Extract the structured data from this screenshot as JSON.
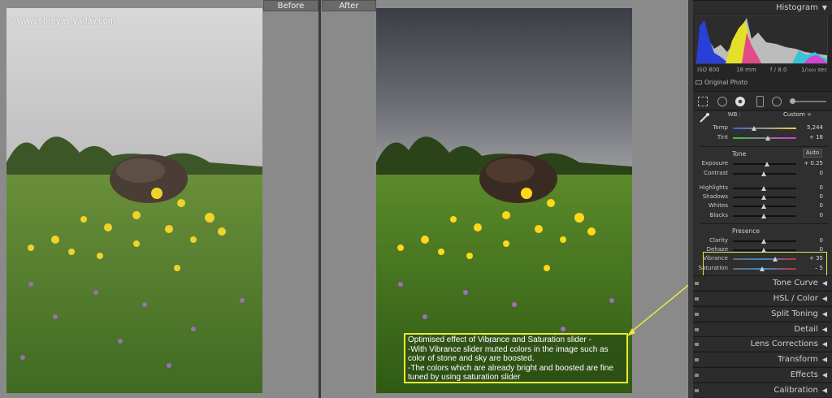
{
  "watermark": "© www.shreyas-yadav.com",
  "before_label": "Before",
  "after_label": "After",
  "annotation_lines": [
    "Optimised effect of Vibrance and Saturation slider -",
    "-With Vibrance slider muted colors in the image such as",
    "color of stone and sky are boosted.",
    "-The colors which are already bright and boosted are fine",
    "tuned  by using saturation slider"
  ],
  "panel": {
    "histogram_title": "Histogram",
    "iso": "ISO 800",
    "focal": "18 mm",
    "aperture": "f / 8.0",
    "shutter": "1/₁₆₀₀ sec",
    "original_photo": "Original Photo",
    "wb_label": "WB :",
    "wb_value": "Custom",
    "temp_label": "Temp",
    "temp_value": "5,244",
    "tint_label": "Tint",
    "tint_value": "+ 18",
    "tone_title": "Tone",
    "auto_label": "Auto",
    "exposure_label": "Exposure",
    "exposure_value": "+ 0.25",
    "contrast_label": "Contrast",
    "contrast_value": "0",
    "highlights_label": "Highlights",
    "highlights_value": "0",
    "shadows_label": "Shadows",
    "shadows_value": "0",
    "whites_label": "Whites",
    "whites_value": "0",
    "blacks_label": "Blacks",
    "blacks_value": "0",
    "presence_title": "Presence",
    "clarity_label": "Clarity",
    "clarity_value": "0",
    "dehaze_label": "Dehaze",
    "dehaze_value": "0",
    "vibrance_label": "Vibrance",
    "vibrance_value": "+ 35",
    "saturation_label": "Saturation",
    "saturation_value": "– 5",
    "sections": [
      "Tone Curve",
      "HSL / Color",
      "Split Toning",
      "Detail",
      "Lens Corrections",
      "Transform",
      "Effects",
      "Calibration"
    ]
  },
  "colors": {
    "highlight_yellow": "#e9e83c",
    "panel_bg": "#2f2f2f"
  }
}
